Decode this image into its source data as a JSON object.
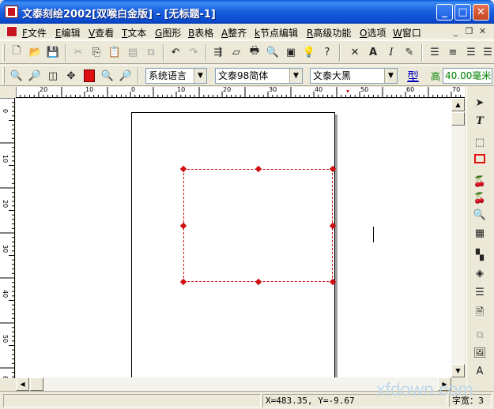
{
  "window": {
    "title": "文泰刻绘2002[双喉白金版] - [无标题-1]"
  },
  "menu": {
    "items": [
      {
        "key": "F",
        "label": "文件"
      },
      {
        "key": "E",
        "label": "编辑"
      },
      {
        "key": "V",
        "label": "查看"
      },
      {
        "key": "T",
        "label": "文本"
      },
      {
        "key": "G",
        "label": "图形"
      },
      {
        "key": "B",
        "label": "表格"
      },
      {
        "key": "A",
        "label": "整齐"
      },
      {
        "key": "k",
        "label": "节点编辑"
      },
      {
        "key": "R",
        "label": "高级功能"
      },
      {
        "key": "O",
        "label": "选项"
      },
      {
        "key": "W",
        "label": "窗口"
      }
    ]
  },
  "format_bar": {
    "language": "系统语言",
    "font_en": "文泰98简体",
    "font_cn": "文泰大黑",
    "type_label": "型",
    "height_label": "高",
    "height_value": "40.00毫米"
  },
  "ruler": {
    "h_labels": [
      "20",
      "10",
      "0",
      "10",
      "20",
      "30",
      "40",
      "50",
      "60",
      "70"
    ],
    "v_labels": [
      "0",
      "10",
      "20",
      "30",
      "40",
      "50",
      "60"
    ]
  },
  "status": {
    "coords": "X=483.35, Y=-9.67",
    "page": "字宽：3"
  },
  "watermark": "xfdown.com"
}
